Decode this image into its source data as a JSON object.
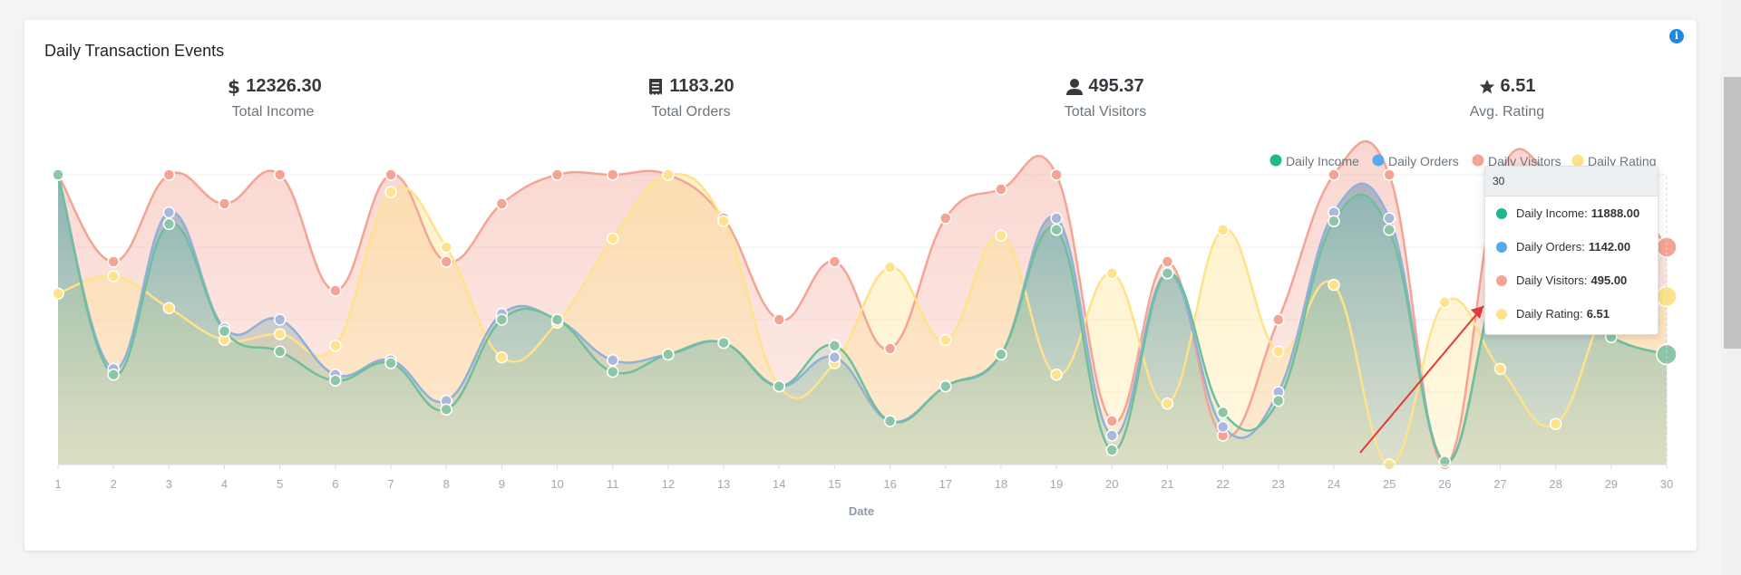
{
  "card": {
    "title": "Daily Transaction Events"
  },
  "stats": [
    {
      "icon": "dollar-icon",
      "value": "12326.30",
      "label": "Total Income"
    },
    {
      "icon": "receipt-icon",
      "value": "1183.20",
      "label": "Total Orders"
    },
    {
      "icon": "user-icon",
      "value": "495.37",
      "label": "Total Visitors"
    },
    {
      "icon": "star-icon",
      "value": "6.51",
      "label": "Avg. Rating"
    }
  ],
  "tooltip": {
    "title": "30",
    "rows": [
      {
        "label": "Daily Income:",
        "value": "11888.00"
      },
      {
        "label": "Daily Orders:",
        "value": "1142.00"
      },
      {
        "label": "Daily Visitors:",
        "value": "495.00"
      },
      {
        "label": "Daily Rating:",
        "value": "6.51"
      }
    ]
  },
  "colors": {
    "income": "#1fb88e",
    "orders": "#5aa9f0",
    "visitors": "#f4a495",
    "rating": "#ffe28a",
    "accent": "#1e88e5"
  },
  "chart_data": {
    "type": "area",
    "xlabel": "Date",
    "ylabel": "",
    "categories": [
      "1",
      "2",
      "3",
      "4",
      "5",
      "6",
      "7",
      "8",
      "9",
      "10",
      "11",
      "12",
      "13",
      "14",
      "15",
      "16",
      "17",
      "18",
      "19",
      "20",
      "21",
      "22",
      "23",
      "24",
      "25",
      "26",
      "27",
      "28",
      "29",
      "30"
    ],
    "series": [
      {
        "name": "Daily Income",
        "values": [
          0.0,
          0.69,
          0.17,
          0.54,
          0.61,
          0.71,
          0.65,
          0.81,
          0.5,
          0.5,
          0.68,
          0.62,
          0.58,
          0.73,
          0.59,
          0.85,
          0.73,
          0.62,
          0.19,
          0.95,
          0.34,
          0.82,
          0.78,
          0.16,
          0.19,
          0.99,
          0.35,
          0.4,
          0.56,
          0.62
        ]
      },
      {
        "name": "Daily Orders",
        "values": [
          0.0,
          0.67,
          0.13,
          0.53,
          0.5,
          0.69,
          0.64,
          0.78,
          0.48,
          0.5,
          0.64,
          0.62,
          0.58,
          0.73,
          0.63,
          0.85,
          0.73,
          0.62,
          0.15,
          0.9,
          0.34,
          0.87,
          0.75,
          0.13,
          0.15,
          0.99,
          0.35,
          0.4,
          0.56,
          0.62
        ]
      },
      {
        "name": "Daily Visitors",
        "values": [
          0.0,
          0.3,
          0.0,
          0.1,
          0.0,
          0.4,
          0.0,
          0.3,
          0.1,
          0.0,
          0.0,
          0.0,
          0.15,
          0.5,
          0.3,
          0.6,
          0.15,
          0.05,
          0.0,
          0.85,
          0.3,
          0.9,
          0.5,
          0.0,
          0.0,
          1.0,
          0.0,
          0.0,
          0.0,
          0.25
        ]
      },
      {
        "name": "Daily Rating",
        "values": [
          0.41,
          0.35,
          0.46,
          0.57,
          0.55,
          0.59,
          0.06,
          0.25,
          0.63,
          0.51,
          0.22,
          0.0,
          0.16,
          0.73,
          0.65,
          0.32,
          0.57,
          0.21,
          0.69,
          0.34,
          0.79,
          0.19,
          0.61,
          0.38,
          1.0,
          0.44,
          0.67,
          0.86,
          0.43,
          0.42
        ]
      }
    ],
    "legend": "top-right",
    "grid": true
  }
}
